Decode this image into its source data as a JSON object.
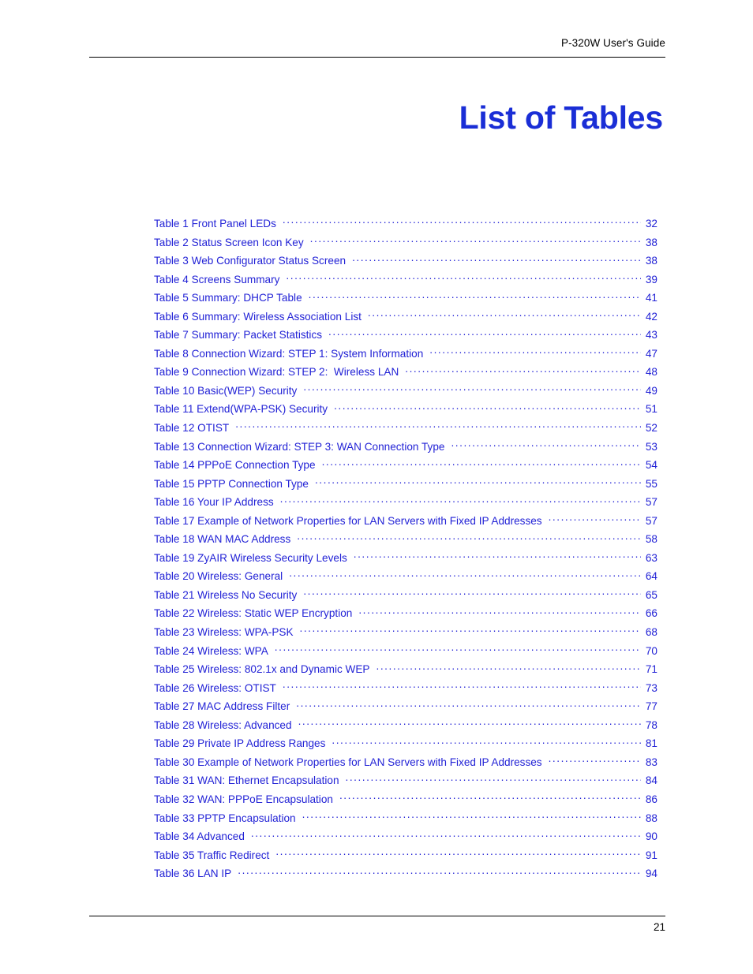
{
  "header": {
    "title": "P-320W User's Guide"
  },
  "page_title": "List of Tables",
  "footer": {
    "page_number": "21"
  },
  "colors": {
    "entry_blue": "#2222d6",
    "title_blue": "#1a2ed6",
    "rule_black": "#000000",
    "background": "#ffffff"
  },
  "toc": {
    "entries": [
      {
        "label": "Table 1 Front Panel LEDs",
        "page": "32"
      },
      {
        "label": "Table 2 Status Screen Icon Key",
        "page": "38"
      },
      {
        "label": "Table 3 Web Configurator Status Screen",
        "page": "38"
      },
      {
        "label": "Table 4 Screens Summary",
        "page": "39"
      },
      {
        "label": "Table 5 Summary: DHCP Table",
        "page": "41"
      },
      {
        "label": "Table 6 Summary: Wireless Association List",
        "page": "42"
      },
      {
        "label": "Table 7 Summary: Packet Statistics",
        "page": "43"
      },
      {
        "label": "Table 8 Connection Wizard: STEP 1: System Information",
        "page": "47"
      },
      {
        "label": "Table 9 Connection Wizard: STEP 2:  Wireless LAN",
        "page": "48"
      },
      {
        "label": "Table 10 Basic(WEP) Security",
        "page": "49"
      },
      {
        "label": "Table 11 Extend(WPA-PSK) Security",
        "page": "51"
      },
      {
        "label": "Table 12 OTIST",
        "page": "52"
      },
      {
        "label": "Table 13 Connection Wizard: STEP 3: WAN Connection Type",
        "page": "53"
      },
      {
        "label": "Table 14 PPPoE Connection Type",
        "page": "54"
      },
      {
        "label": "Table 15 PPTP Connection Type",
        "page": "55"
      },
      {
        "label": "Table 16 Your IP Address",
        "page": "57"
      },
      {
        "label": "Table 17 Example of Network Properties for LAN Servers with Fixed IP Addresses",
        "page": "57"
      },
      {
        "label": "Table 18 WAN MAC Address",
        "page": "58"
      },
      {
        "label": "Table 19 ZyAIR Wireless Security Levels",
        "page": "63"
      },
      {
        "label": "Table 20 Wireless: General",
        "page": "64"
      },
      {
        "label": "Table 21 Wireless No Security",
        "page": "65"
      },
      {
        "label": "Table 22 Wireless: Static WEP Encryption",
        "page": "66"
      },
      {
        "label": "Table 23 Wireless: WPA-PSK",
        "page": "68"
      },
      {
        "label": "Table 24 Wireless: WPA",
        "page": "70"
      },
      {
        "label": "Table 25 Wireless: 802.1x and Dynamic WEP",
        "page": "71"
      },
      {
        "label": "Table 26 Wireless: OTIST",
        "page": "73"
      },
      {
        "label": "Table 27 MAC Address Filter",
        "page": "77"
      },
      {
        "label": "Table 28 Wireless: Advanced",
        "page": "78"
      },
      {
        "label": "Table 29 Private IP Address Ranges",
        "page": "81"
      },
      {
        "label": "Table 30 Example of Network Properties for LAN Servers with Fixed IP Addresses",
        "page": "83"
      },
      {
        "label": "Table 31 WAN: Ethernet Encapsulation",
        "page": "84"
      },
      {
        "label": "Table 32 WAN: PPPoE Encapsulation",
        "page": "86"
      },
      {
        "label": "Table 33 PPTP Encapsulation",
        "page": "88"
      },
      {
        "label": "Table 34 Advanced",
        "page": "90"
      },
      {
        "label": "Table 35 Traffic Redirect",
        "page": "91"
      },
      {
        "label": "Table 36 LAN IP",
        "page": "94"
      }
    ]
  }
}
